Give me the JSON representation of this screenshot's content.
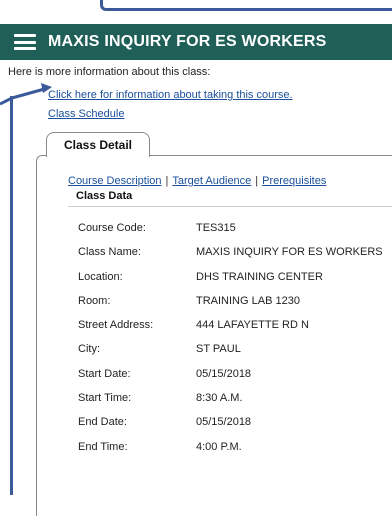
{
  "header": {
    "title": "MAXIS INQUIRY FOR ES WORKERS"
  },
  "intro": {
    "text": "Here is more information about this class:",
    "info_link": "Click here for information about taking this course.",
    "schedule_link": "Class Schedule"
  },
  "tab": {
    "label": "Class Detail"
  },
  "sublinks": {
    "course_description": "Course Description",
    "target_audience": "Target Audience",
    "prerequisites": "Prerequisites",
    "separator": "|"
  },
  "section": {
    "title": "Class Data"
  },
  "class_data": [
    {
      "label": "Course Code:",
      "value": "TES315"
    },
    {
      "label": "Class Name:",
      "value": "MAXIS INQUIRY FOR ES WORKERS"
    },
    {
      "label": "Location:",
      "value": "DHS TRAINING CENTER"
    },
    {
      "label": "Room:",
      "value": "TRAINING LAB 1230"
    },
    {
      "label": "Street Address:",
      "value": "444 LAFAYETTE RD N"
    },
    {
      "label": "City:",
      "value": "ST PAUL"
    },
    {
      "label": "Start Date:",
      "value": "05/15/2018"
    },
    {
      "label": "Start Time:",
      "value": "8:30 A.M."
    },
    {
      "label": "End Date:",
      "value": "05/15/2018"
    },
    {
      "label": "End Time:",
      "value": "4:00 P.M."
    }
  ],
  "colors": {
    "header_bg": "#1f5f58",
    "link": "#1a4f9c",
    "annotation": "#3c5a9a"
  },
  "icons": {
    "menu": "hamburger-menu-icon"
  }
}
